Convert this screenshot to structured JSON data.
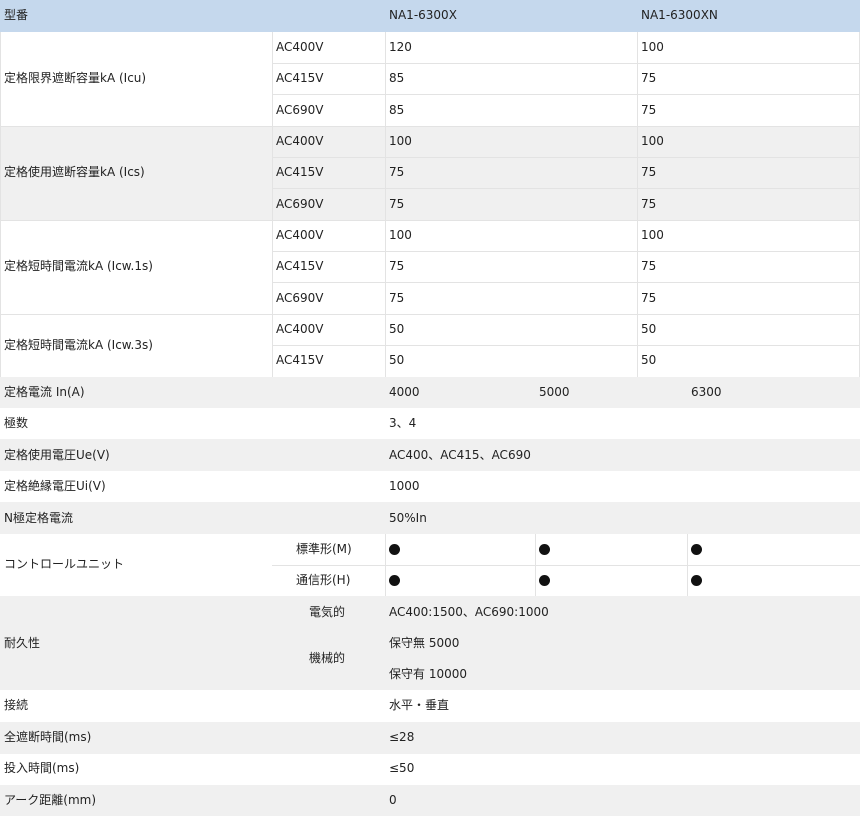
{
  "header": {
    "label": "型番",
    "model_x": "NA1-6300X",
    "model_xn": "NA1-6300XN"
  },
  "breaking": [
    {
      "label": "定格限界遮断容量kA (Icu)",
      "rows": [
        {
          "voltage": "AC400V",
          "x": "120",
          "xn": "100"
        },
        {
          "voltage": "AC415V",
          "x": "85",
          "xn": "75"
        },
        {
          "voltage": "AC690V",
          "x": "85",
          "xn": "75"
        }
      ]
    },
    {
      "label": "定格使用遮断容量kA (Ics)",
      "rows": [
        {
          "voltage": "AC400V",
          "x": "100",
          "xn": "100"
        },
        {
          "voltage": "AC415V",
          "x": "75",
          "xn": "75"
        },
        {
          "voltage": "AC690V",
          "x": "75",
          "xn": "75"
        }
      ]
    },
    {
      "label": "定格短時間電流kA (Icw.1s)",
      "rows": [
        {
          "voltage": "AC400V",
          "x": "100",
          "xn": "100"
        },
        {
          "voltage": "AC415V",
          "x": "75",
          "xn": "75"
        },
        {
          "voltage": "AC690V",
          "x": "75",
          "xn": "75"
        }
      ]
    },
    {
      "label": "定格短時間電流kA (Icw.3s)",
      "rows": [
        {
          "voltage": "AC400V",
          "x": "50",
          "xn": "50"
        },
        {
          "voltage": "AC415V",
          "x": "50",
          "xn": "50"
        }
      ]
    }
  ],
  "rated_current": {
    "label": "定格電流 In(A)",
    "values": [
      "4000",
      "5000",
      "6300"
    ]
  },
  "poles": {
    "label": "極数",
    "value": "3、4"
  },
  "ue": {
    "label": "定格使用電圧Ue(V)",
    "value": "AC400、AC415、AC690"
  },
  "ui": {
    "label": "定格絶縁電圧Ui(V)",
    "value": "1000"
  },
  "n_pole": {
    "label": "N極定格電流",
    "value": "50%In"
  },
  "control_unit": {
    "label": "コントロールユニット",
    "standard": "標準形(M)",
    "comm": "通信形(H)",
    "mark": "●"
  },
  "durability": {
    "label": "耐久性",
    "electrical": "電気的",
    "electrical_value": "AC400:1500、AC690:1000",
    "mechanical": "機械的",
    "mech_value_1": "保守無 5000",
    "mech_value_2": "保守有 10000"
  },
  "connection": {
    "label": "接続",
    "value": "水平・垂直"
  },
  "total_break": {
    "label": "全遮断時間(ms)",
    "value": "≤28"
  },
  "closing": {
    "label": "投入時間(ms)",
    "value": "≤50"
  },
  "arc": {
    "label": "アーク距離(mm)",
    "value": "0"
  }
}
